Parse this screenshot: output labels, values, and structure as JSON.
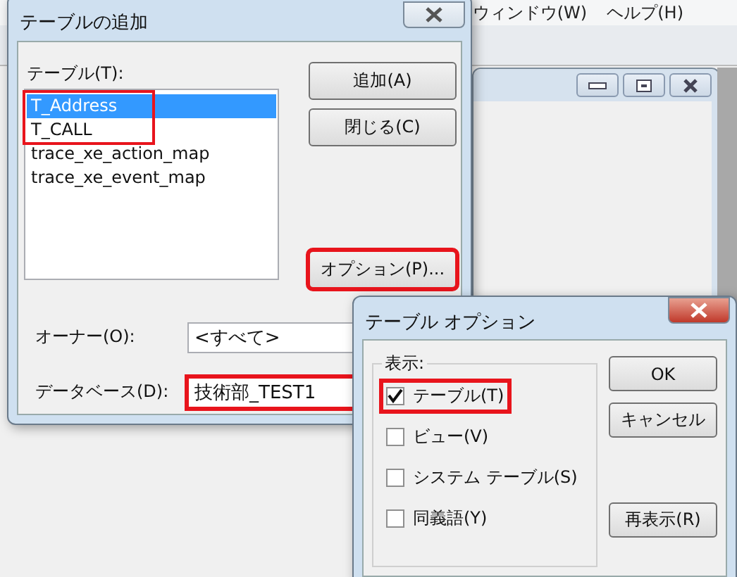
{
  "background_app": {
    "menu": [
      "ウィンドウ(W)",
      "ヘルプ(H)"
    ]
  },
  "add_table_dialog": {
    "title": "テーブルの追加",
    "list_label": "テーブル(T):",
    "tables": [
      {
        "name": "T_Address",
        "selected": true,
        "highlighted": true
      },
      {
        "name": "T_CALL",
        "selected": false,
        "highlighted": true
      },
      {
        "name": "trace_xe_action_map",
        "selected": false,
        "highlighted": false
      },
      {
        "name": "trace_xe_event_map",
        "selected": false,
        "highlighted": false
      }
    ],
    "buttons": [
      {
        "label": "追加(A)",
        "highlighted": false
      },
      {
        "label": "閉じる(C)",
        "highlighted": false
      },
      {
        "label": "オプション(P)...",
        "highlighted": true
      }
    ],
    "owner": {
      "label": "オーナー(O):",
      "value": "<すべて>",
      "highlighted": false
    },
    "database": {
      "label": "データベース(D):",
      "value": "技術部_TEST1",
      "highlighted": true
    }
  },
  "table_options_dialog": {
    "title": "テーブル オプション",
    "group_label": "表示:",
    "options": [
      {
        "label": "テーブル(T)",
        "checked": true,
        "highlighted": true
      },
      {
        "label": "ビュー(V)",
        "checked": false,
        "highlighted": false
      },
      {
        "label": "システム テーブル(S)",
        "checked": false,
        "highlighted": false
      },
      {
        "label": "同義語(Y)",
        "checked": false,
        "highlighted": false
      }
    ],
    "buttons": [
      "OK",
      "キャンセル",
      "再表示(R)"
    ]
  }
}
